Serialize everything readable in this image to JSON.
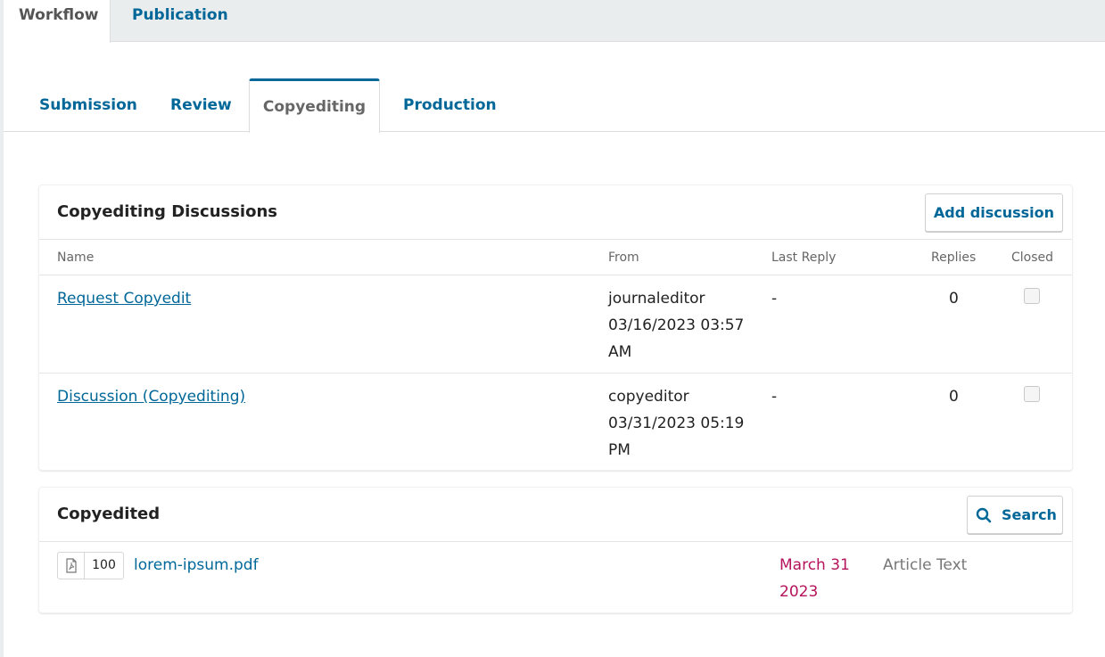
{
  "top_tabs": {
    "active": "Workflow",
    "other": "Publication"
  },
  "stage_tabs": [
    "Submission",
    "Review",
    "Copyediting",
    "Production"
  ],
  "discussions": {
    "title": "Copyediting Discussions",
    "add_button": "Add discussion",
    "columns": {
      "name": "Name",
      "from": "From",
      "last_reply": "Last Reply",
      "replies": "Replies",
      "closed": "Closed"
    },
    "rows": [
      {
        "name": "Request Copyedit",
        "from_user": "journaleditor",
        "from_date": "03/16/2023 03:57 AM",
        "last_reply": "-",
        "replies": "0",
        "closed": false
      },
      {
        "name": "Discussion (Copyediting)",
        "from_user": "copyeditor",
        "from_date": "03/31/2023 05:19 PM",
        "last_reply": "-",
        "replies": "0",
        "closed": false
      }
    ]
  },
  "copyedited": {
    "title": "Copyedited",
    "search_button": "Search",
    "files": [
      {
        "id": "100",
        "name": "lorem-ipsum.pdf",
        "date": "March 31 2023",
        "type": "Article Text"
      }
    ]
  },
  "colors": {
    "link": "#006798",
    "date": "#b5135c",
    "tab_bar": "#eaedee"
  }
}
